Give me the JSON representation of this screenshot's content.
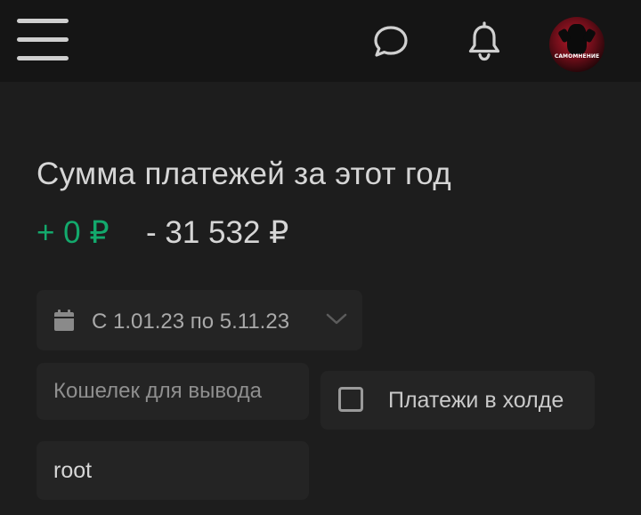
{
  "header": {
    "menu_icon": "hamburger-menu-icon",
    "chat_icon": "chat-bubble-icon",
    "notifications_icon": "bell-icon",
    "avatar_caption": "САМОМНЕНИЕ"
  },
  "summary": {
    "title": "Сумма платежей за этот год",
    "income": "+ 0 ₽",
    "expense": "- 31 532 ₽",
    "income_color": "#13a96c"
  },
  "filters": {
    "date_range": {
      "icon": "calendar-icon",
      "label": "С 1.01.23 по 5.11.23",
      "chevron_icon": "chevron-down-icon"
    },
    "wallet": {
      "placeholder": "Кошелек для вывода",
      "value": ""
    },
    "hold": {
      "label": "Платежи в холде",
      "checked": false
    },
    "login": {
      "value": "root"
    }
  }
}
